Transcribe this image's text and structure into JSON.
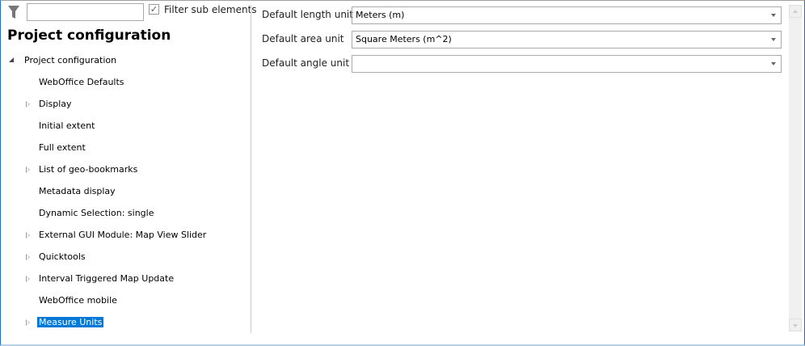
{
  "filter": {
    "search_value": "",
    "checkbox_label": "Filter sub elements",
    "checked": true
  },
  "panel_title": "Project configuration",
  "tree": {
    "root": "Project configuration",
    "items": [
      {
        "label": "WebOffice Defaults",
        "expandable": false
      },
      {
        "label": "Display",
        "expandable": true
      },
      {
        "label": "Initial extent",
        "expandable": false
      },
      {
        "label": "Full extent",
        "expandable": false
      },
      {
        "label": "List of geo-bookmarks",
        "expandable": true
      },
      {
        "label": "Metadata display",
        "expandable": false
      },
      {
        "label": "Dynamic Selection: single",
        "expandable": false
      },
      {
        "label": "External GUI Module: Map View Slider",
        "expandable": true
      },
      {
        "label": "Quicktools",
        "expandable": true
      },
      {
        "label": "Interval Triggered Map Update",
        "expandable": true
      },
      {
        "label": "WebOffice mobile",
        "expandable": false
      },
      {
        "label": "Measure Units",
        "expandable": true,
        "selected": true
      }
    ]
  },
  "properties": [
    {
      "label": "Default length unit",
      "value": "Meters (m)"
    },
    {
      "label": "Default area unit",
      "value": "Square Meters (m^2)"
    },
    {
      "label": "Default angle unit",
      "value": ""
    }
  ],
  "colors": {
    "selection": "#0078d7",
    "accent_border": "#1c6fc4"
  }
}
